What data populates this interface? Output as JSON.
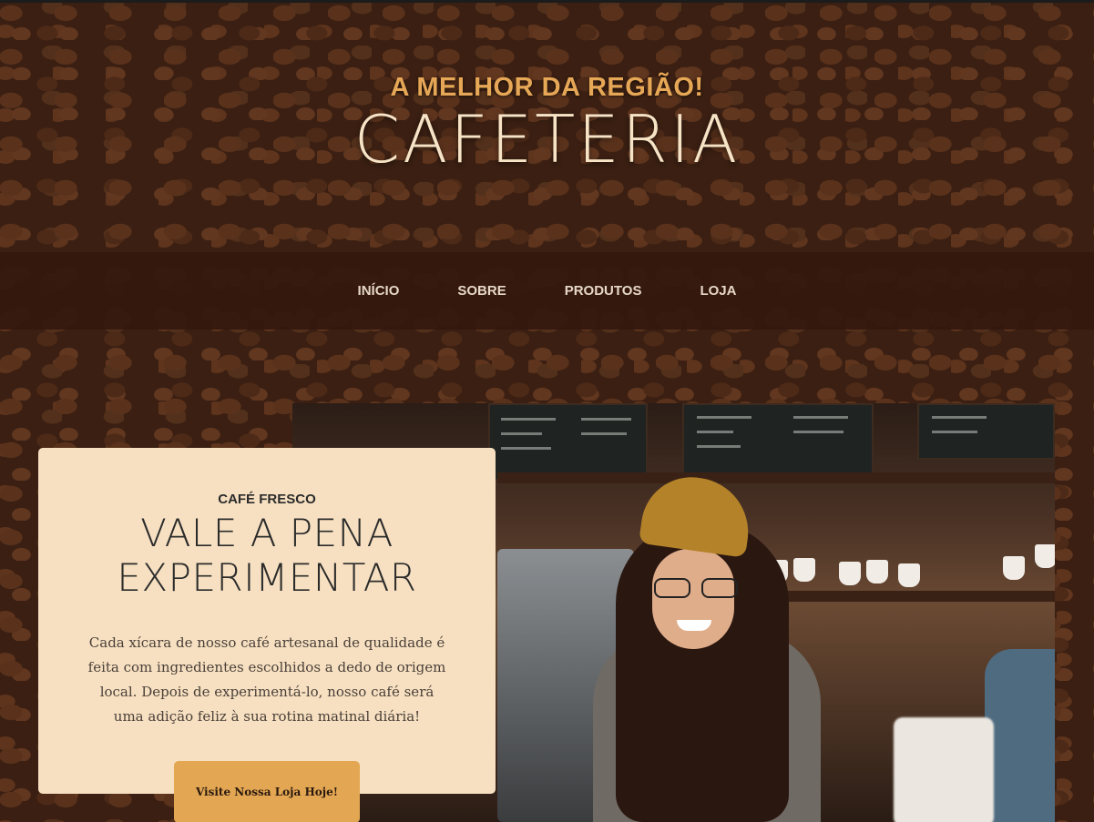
{
  "header": {
    "tagline": "A MELHOR DA REGIÃO!",
    "title": "CAFETERIA"
  },
  "nav": {
    "items": [
      {
        "label": "INÍCIO"
      },
      {
        "label": "SOBRE"
      },
      {
        "label": "PRODUTOS"
      },
      {
        "label": "LOJA"
      }
    ]
  },
  "intro": {
    "eyebrow": "CAFÉ FRESCO",
    "heading_line1": "VALE A PENA",
    "heading_line2": "EXPERIMENTAR",
    "text": "Cada xícara de nosso café artesanal de qualidade é feita com ingredientes escolhidos a dedo de origem local. Depois de experimentá-lo, nosso café será uma adição feliz à sua rotina matinal diária!",
    "button_label": "Visite Nossa Loja Hoje!"
  },
  "colors": {
    "accent": "#e6a756",
    "card_bg": "#f7e0c1",
    "nav_bg": "#34180e",
    "title": "#f7e4c6"
  }
}
